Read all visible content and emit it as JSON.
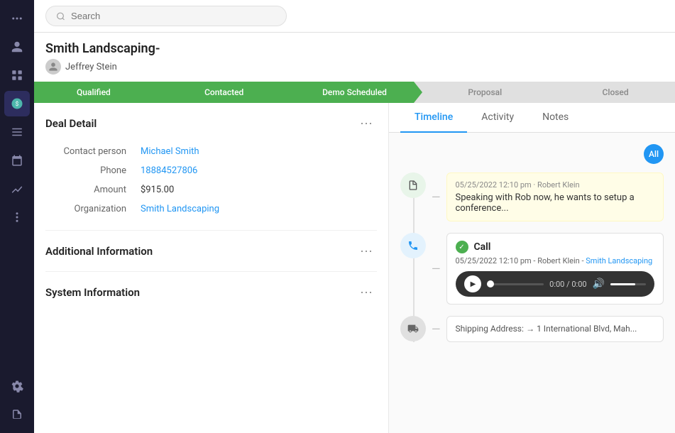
{
  "sidebar": {
    "icons": [
      {
        "name": "dots-icon",
        "symbol": "⠿",
        "active": false
      },
      {
        "name": "contacts-icon",
        "symbol": "👤",
        "active": false
      },
      {
        "name": "dashboard-icon",
        "symbol": "▦",
        "active": false
      },
      {
        "name": "deals-icon",
        "symbol": "$",
        "active": true
      },
      {
        "name": "tasks-icon",
        "symbol": "☰",
        "active": false
      },
      {
        "name": "calendar-icon",
        "symbol": "📅",
        "active": false
      },
      {
        "name": "analytics-icon",
        "symbol": "📈",
        "active": false
      },
      {
        "name": "more-icon",
        "symbol": "···",
        "active": false
      },
      {
        "name": "settings-icon",
        "symbol": "⚙",
        "active": false
      },
      {
        "name": "export-icon",
        "symbol": "↗",
        "active": false
      }
    ]
  },
  "search": {
    "placeholder": "Search"
  },
  "deal": {
    "title": "Smith Landscaping-",
    "owner": "Jeffrey Stein"
  },
  "pipeline": {
    "stages": [
      {
        "label": "Qualified",
        "active": true
      },
      {
        "label": "Contacted",
        "active": true
      },
      {
        "label": "Demo Scheduled",
        "active": true
      },
      {
        "label": "Proposal",
        "active": false
      },
      {
        "label": "Closed",
        "active": false
      }
    ]
  },
  "deal_detail": {
    "title": "Deal Detail",
    "fields": [
      {
        "label": "Contact person",
        "value": "Michael Smith",
        "link": true
      },
      {
        "label": "Phone",
        "value": "18884527806",
        "link": true
      },
      {
        "label": "Amount",
        "value": "$915.00",
        "link": false
      },
      {
        "label": "Organization",
        "value": "Smith Landscaping",
        "link": true
      }
    ],
    "more_btn": "···"
  },
  "additional_info": {
    "title": "Additional Information",
    "more_btn": "···"
  },
  "system_info": {
    "title": "System Information",
    "more_btn": "···"
  },
  "tabs": [
    {
      "label": "Timeline",
      "active": true
    },
    {
      "label": "Activity",
      "active": false
    },
    {
      "label": "Notes",
      "active": false
    }
  ],
  "filter": {
    "label": "All"
  },
  "timeline": {
    "items": [
      {
        "type": "note",
        "timestamp": "05/25/2022 12:10 pm · Robert Klein",
        "text": "Speaking with Rob now, he wants to setup a conference..."
      },
      {
        "type": "call",
        "label": "Call",
        "timestamp": "05/25/2022 12:10 pm - Robert Klein -",
        "org_link": "Smith Landscaping",
        "audio_time": "0:00 / 0:00"
      },
      {
        "type": "shipping",
        "label": "Shipping Address:",
        "text": "→  1 International Blvd, Mah..."
      }
    ]
  }
}
